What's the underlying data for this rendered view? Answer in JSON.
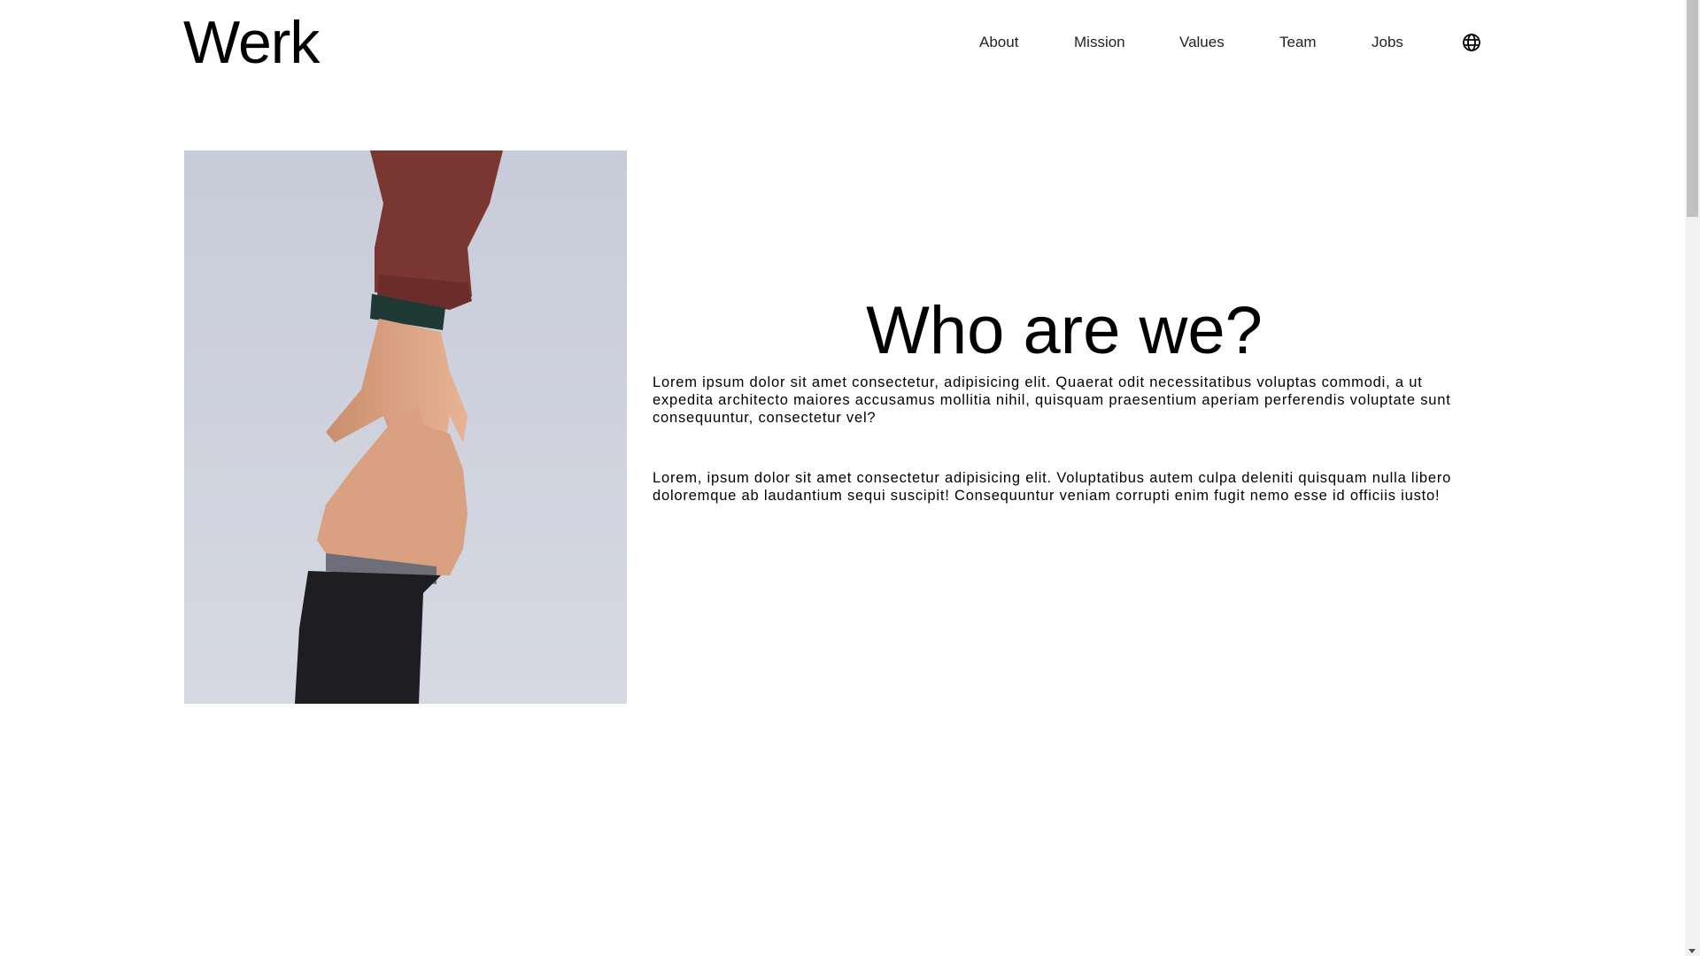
{
  "header": {
    "logo": "Werk",
    "nav": {
      "about": "About",
      "mission": "Mission",
      "values": "Values",
      "team": "Team",
      "jobs": "Jobs"
    },
    "language_icon": "globe-icon"
  },
  "main": {
    "image_alt": "hands-reaching-photo",
    "heading": "Who are we?",
    "paragraphs": [
      "Lorem ipsum dolor sit amet consectetur, adipisicing elit. Quaerat odit necessitatibus voluptas commodi, a ut expedita architecto maiores accusamus mollitia nihil, quisquam praesentium aperiam perferendis voluptate sunt consequuntur, consectetur vel?",
      "Lorem, ipsum dolor sit amet consectetur adipisicing elit. Voluptatibus autem culpa deleniti quisquam nulla libero doloremque ab laudantium sequi suscipit! Consequuntur veniam corrupti enim fugit nemo esse id officiis iusto!"
    ]
  },
  "colors": {
    "background": "#ffffff",
    "text": "#000000",
    "image_sky": "#cfd3df"
  }
}
